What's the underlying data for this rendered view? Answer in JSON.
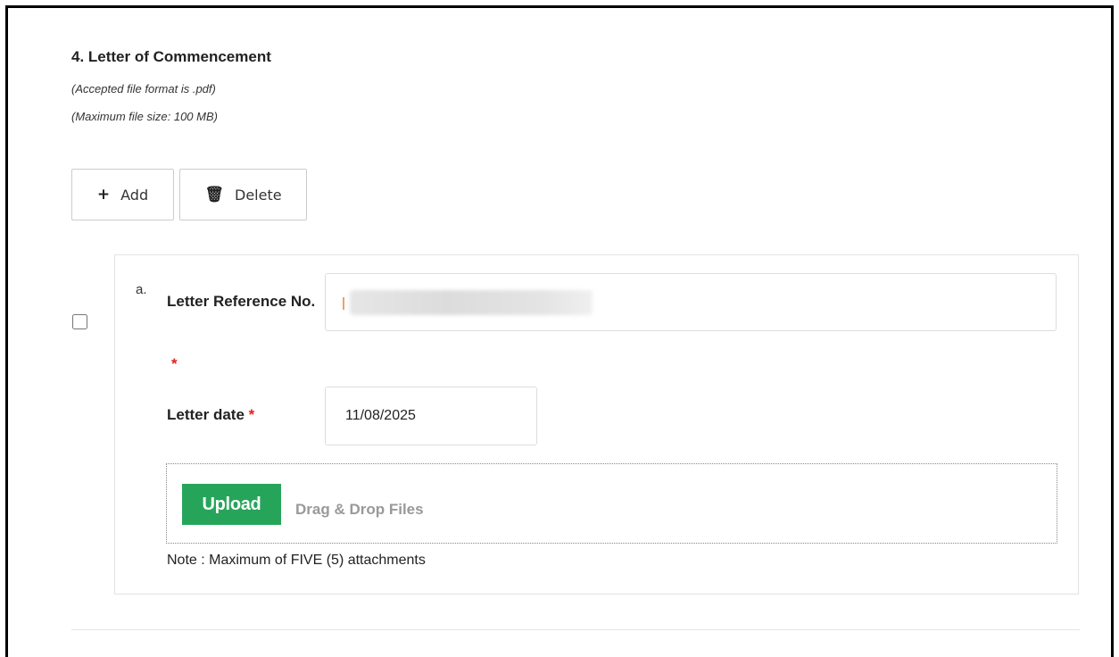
{
  "section": {
    "title": "4. Letter of Commencement",
    "format_hint": "(Accepted file format is .pdf)",
    "size_hint": "(Maximum file size: 100 MB)"
  },
  "toolbar": {
    "add_icon": "+",
    "add_label": "Add",
    "delete_icon": "🗑",
    "delete_label": "Delete"
  },
  "item": {
    "index": "a.",
    "ref_label": "Letter Reference No.",
    "ref_value": "",
    "date_label": "Letter date",
    "date_value": "11/08/2025",
    "required_mark": "*"
  },
  "upload": {
    "button_label": "Upload",
    "drop_text": "Drag & Drop Files",
    "note": "Note : Maximum of FIVE (5) attachments"
  },
  "colors": {
    "upload_green": "#26a55a",
    "required_red": "#e02020"
  }
}
